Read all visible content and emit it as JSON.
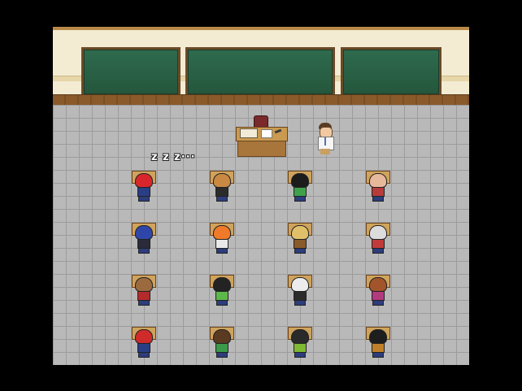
{
  "game": {
    "scene": "classroom",
    "sleep_indicator": "z z z···"
  },
  "colors": {
    "background": "#000000",
    "wall": "#f3ecd3",
    "chalkboard": "#2f6b4e",
    "wood_rail": "#8a5a2b",
    "floor_tile": "#b9b9b9",
    "desk": "#cfa35c"
  },
  "teacher": {
    "sprite": "teacher-white-coat"
  },
  "students": [
    {
      "hair": "#d9262c",
      "shirt": "#2a3e86",
      "sleeping": true
    },
    {
      "hair": "#c98943",
      "shirt": "#2b2b2b",
      "sleeping": false
    },
    {
      "hair": "#1c1c1c",
      "shirt": "#3fa24a",
      "sleeping": false
    },
    {
      "hair": "#e8b89a",
      "shirt": "#b63b3b",
      "sleeping": false
    },
    {
      "hair": "#2e46a8",
      "shirt": "#2a2a3a",
      "sleeping": false
    },
    {
      "hair": "#f07a2a",
      "shirt": "#e9e9e9",
      "sleeping": false
    },
    {
      "hair": "#e1c06a",
      "shirt": "#8a5a2b",
      "sleeping": false
    },
    {
      "hair": "#dcdcdc",
      "shirt": "#c23b3b",
      "sleeping": false
    },
    {
      "hair": "#9b6a3e",
      "shirt": "#b32b2b",
      "sleeping": false
    },
    {
      "hair": "#232323",
      "shirt": "#5cb84a",
      "sleeping": false
    },
    {
      "hair": "#ececec",
      "shirt": "#2b2b2b",
      "sleeping": false
    },
    {
      "hair": "#a2552a",
      "shirt": "#b23a7e",
      "sleeping": false
    },
    {
      "hair": "#cf2b2b",
      "shirt": "#2a3e86",
      "sleeping": false
    },
    {
      "hair": "#5a3b22",
      "shirt": "#3a9a4a",
      "sleeping": false
    },
    {
      "hair": "#2a2a2a",
      "shirt": "#7fb832",
      "sleeping": false
    },
    {
      "hair": "#1e1e1e",
      "shirt": "#c0802a",
      "sleeping": false
    }
  ]
}
